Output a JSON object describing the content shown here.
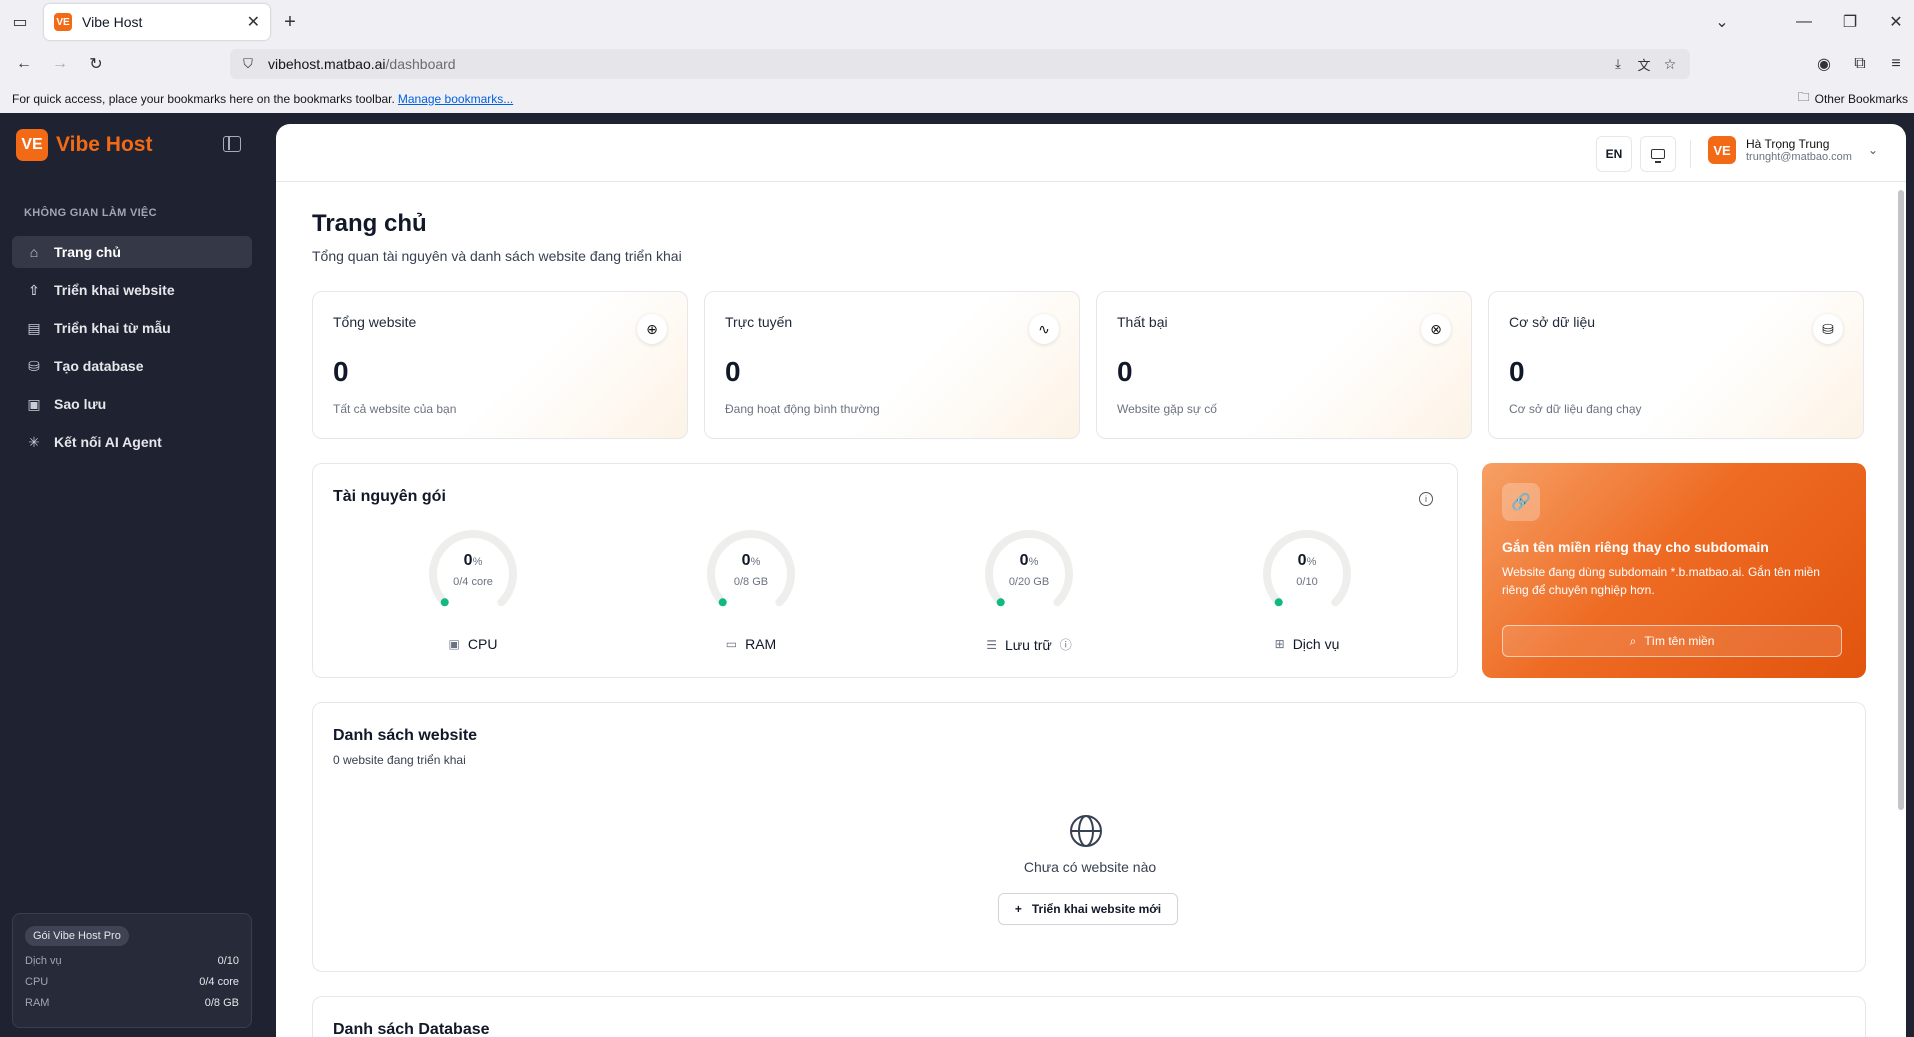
{
  "browser": {
    "tab_title": "Vibe Host",
    "url_host": "vibehost.matbao.ai",
    "url_path": "/dashboard",
    "bookmark_hint": "For quick access, place your bookmarks here on the bookmarks toolbar.",
    "manage_bookmarks": "Manage bookmarks...",
    "other_bookmarks": "Other Bookmarks"
  },
  "sidebar": {
    "brand": "Vibe Host",
    "logo_mark": "VE",
    "section": "KHÔNG GIAN LÀM VIỆC",
    "items": [
      {
        "label": "Trang chủ",
        "icon": "home-icon"
      },
      {
        "label": "Triển khai website",
        "icon": "rocket-icon"
      },
      {
        "label": "Triển khai từ mẫu",
        "icon": "template-icon"
      },
      {
        "label": "Tạo database",
        "icon": "database-icon"
      },
      {
        "label": "Sao lưu",
        "icon": "backup-icon"
      },
      {
        "label": "Kết nối AI Agent",
        "icon": "ai-agent-icon"
      }
    ],
    "plan": {
      "badge": "Gói Vibe Host Pro",
      "rows": [
        {
          "label": "Dịch vụ",
          "value": "0/10"
        },
        {
          "label": "CPU",
          "value": "0/4 core"
        },
        {
          "label": "RAM",
          "value": "0/8 GB"
        }
      ]
    }
  },
  "header": {
    "lang": "EN",
    "user_name": "Hà Trọng Trung",
    "user_email": "trunght@matbao.com",
    "avatar": "VE"
  },
  "page": {
    "title": "Trang chủ",
    "subtitle": "Tổng quan tài nguyên và danh sách website đang triển khai"
  },
  "stats": [
    {
      "label": "Tổng website",
      "value": "0",
      "desc": "Tất cả website của bạn",
      "icon": "globe-icon"
    },
    {
      "label": "Trực tuyến",
      "value": "0",
      "desc": "Đang hoạt động bình thường",
      "icon": "activity-icon"
    },
    {
      "label": "Thất bại",
      "value": "0",
      "desc": "Website gặp sự cố",
      "icon": "x-circle-icon"
    },
    {
      "label": "Cơ sở dữ liệu",
      "value": "0",
      "desc": "Cơ sở dữ liệu đang chạy",
      "icon": "database-icon"
    }
  ],
  "resources": {
    "title": "Tài nguyên gói",
    "gauges": [
      {
        "label": "CPU",
        "percent": "0",
        "unit": "%",
        "usage": "0/4 core",
        "fraction": 0
      },
      {
        "label": "RAM",
        "percent": "0",
        "unit": "%",
        "usage": "0/8 GB",
        "fraction": 0
      },
      {
        "label": "Lưu trữ",
        "percent": "0",
        "unit": "%",
        "usage": "0/20 GB",
        "fraction": 0
      },
      {
        "label": "Dịch vụ",
        "percent": "0",
        "unit": "%",
        "usage": "0/10",
        "fraction": 0
      }
    ]
  },
  "promo": {
    "title": "Gắn tên miền riêng thay cho subdomain",
    "text": "Website đang dùng subdomain *.b.matbao.ai. Gắn tên miền riêng để chuyên nghiệp hơn.",
    "button": "Tìm tên miền"
  },
  "websites": {
    "title": "Danh sách website",
    "count": "0 website đang triển khai",
    "empty": "Chưa có website nào",
    "new_button": "Triển khai website mới"
  },
  "databases": {
    "title": "Danh sách Database"
  },
  "colors": {
    "accent": "#f26a16",
    "sidebar_bg": "#1f2230",
    "gauge_dot": "#10b981"
  }
}
